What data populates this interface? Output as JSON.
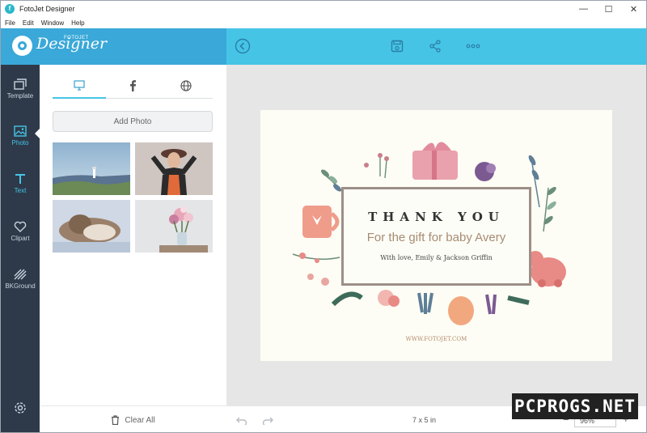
{
  "window": {
    "title": "FotoJet Designer",
    "controls": {
      "minimize": "—",
      "maximize": "☐",
      "close": "✕"
    }
  },
  "menu": [
    "File",
    "Edit",
    "Window",
    "Help"
  ],
  "logo": {
    "script": "Designer",
    "small": "FOTOJET"
  },
  "header": {
    "back_icon": "back-arrow-icon",
    "save_icon": "save-icon",
    "share_icon": "share-icon",
    "more_icon": "more-icon"
  },
  "rail": [
    {
      "label": "Template",
      "icon": "template-icon"
    },
    {
      "label": "Photo",
      "icon": "photo-icon",
      "active": true
    },
    {
      "label": "Text",
      "icon": "text-icon"
    },
    {
      "label": "Clipart",
      "icon": "heart-icon"
    },
    {
      "label": "BKGround",
      "icon": "background-icon"
    }
  ],
  "panel": {
    "tabs": [
      "computer-icon",
      "facebook-icon",
      "globe-icon"
    ],
    "add_photo": "Add Photo",
    "clear_all": "Clear All"
  },
  "card": {
    "title": "THANK YOU",
    "subtitle": "For the gift for baby Avery",
    "signature": "With love, Emily & Jackson Griffin",
    "url": "WWW.FOTOJET.COM"
  },
  "footer": {
    "size": "7 x 5 in",
    "zoom": "96%",
    "zoom_minus": "−",
    "zoom_plus": "+"
  },
  "watermark": "PCPROGS.NET",
  "colors": {
    "accent": "#46c4e6",
    "rail": "#2e3a4a",
    "logo_bg": "#3aa8d8"
  }
}
